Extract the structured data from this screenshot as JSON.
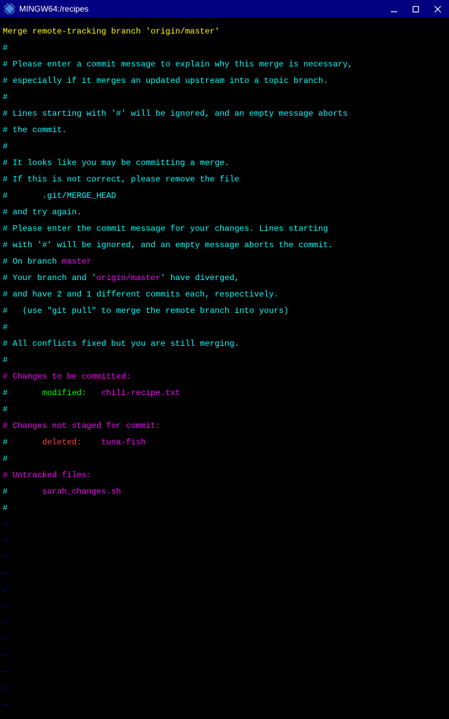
{
  "titlebar": {
    "title": "MINGW64:/recipes"
  },
  "editor": {
    "merge_msg": "Merge remote-tracking branch 'origin/master'",
    "c1": "#",
    "c2": "# Please enter a commit message to explain why this merge is necessary,",
    "c3": "# especially if it merges an updated upstream into a topic branch.",
    "c4": "#",
    "c5": "# Lines starting with '#' will be ignored, and an empty message aborts",
    "c6": "# the commit.",
    "c7": "#",
    "c8": "# It looks like you may be committing a merge.",
    "c9": "# If this is not correct, please remove the file",
    "c10": "#       .git/MERGE_HEAD",
    "c11": "# and try again.",
    "c12": "# Please enter the commit message for your changes. Lines starting",
    "c13": "# with '#' will be ignored, and an empty message aborts the commit.",
    "branch_prefix": "# On branch ",
    "branch_name": "master",
    "div_prefix": "# Your branch and '",
    "div_remote": "origin/master",
    "div_suffix": "' have diverged,",
    "c16": "# and have 2 and 1 different commits each, respectively.",
    "c17": "#   (use \"git pull\" to merge the remote branch into yours)",
    "c18": "#",
    "c19": "# All conflicts fixed but you are still merging.",
    "c20": "#",
    "tobe": "# Changes to be committed:",
    "mod_hash": "#",
    "mod_label": "       modified:   ",
    "mod_file": "chili-recipe.txt",
    "c22": "#",
    "notstaged": "# Changes not staged for commit:",
    "del_hash": "#",
    "del_label": "       deleted:    ",
    "del_file": "tuna-fish",
    "c24": "#",
    "untracked": "# Untracked files:",
    "ut_hash": "#",
    "ut_indent": "       ",
    "ut_file": "sarah_changes.sh",
    "c26": "#",
    "tilde": "~"
  }
}
